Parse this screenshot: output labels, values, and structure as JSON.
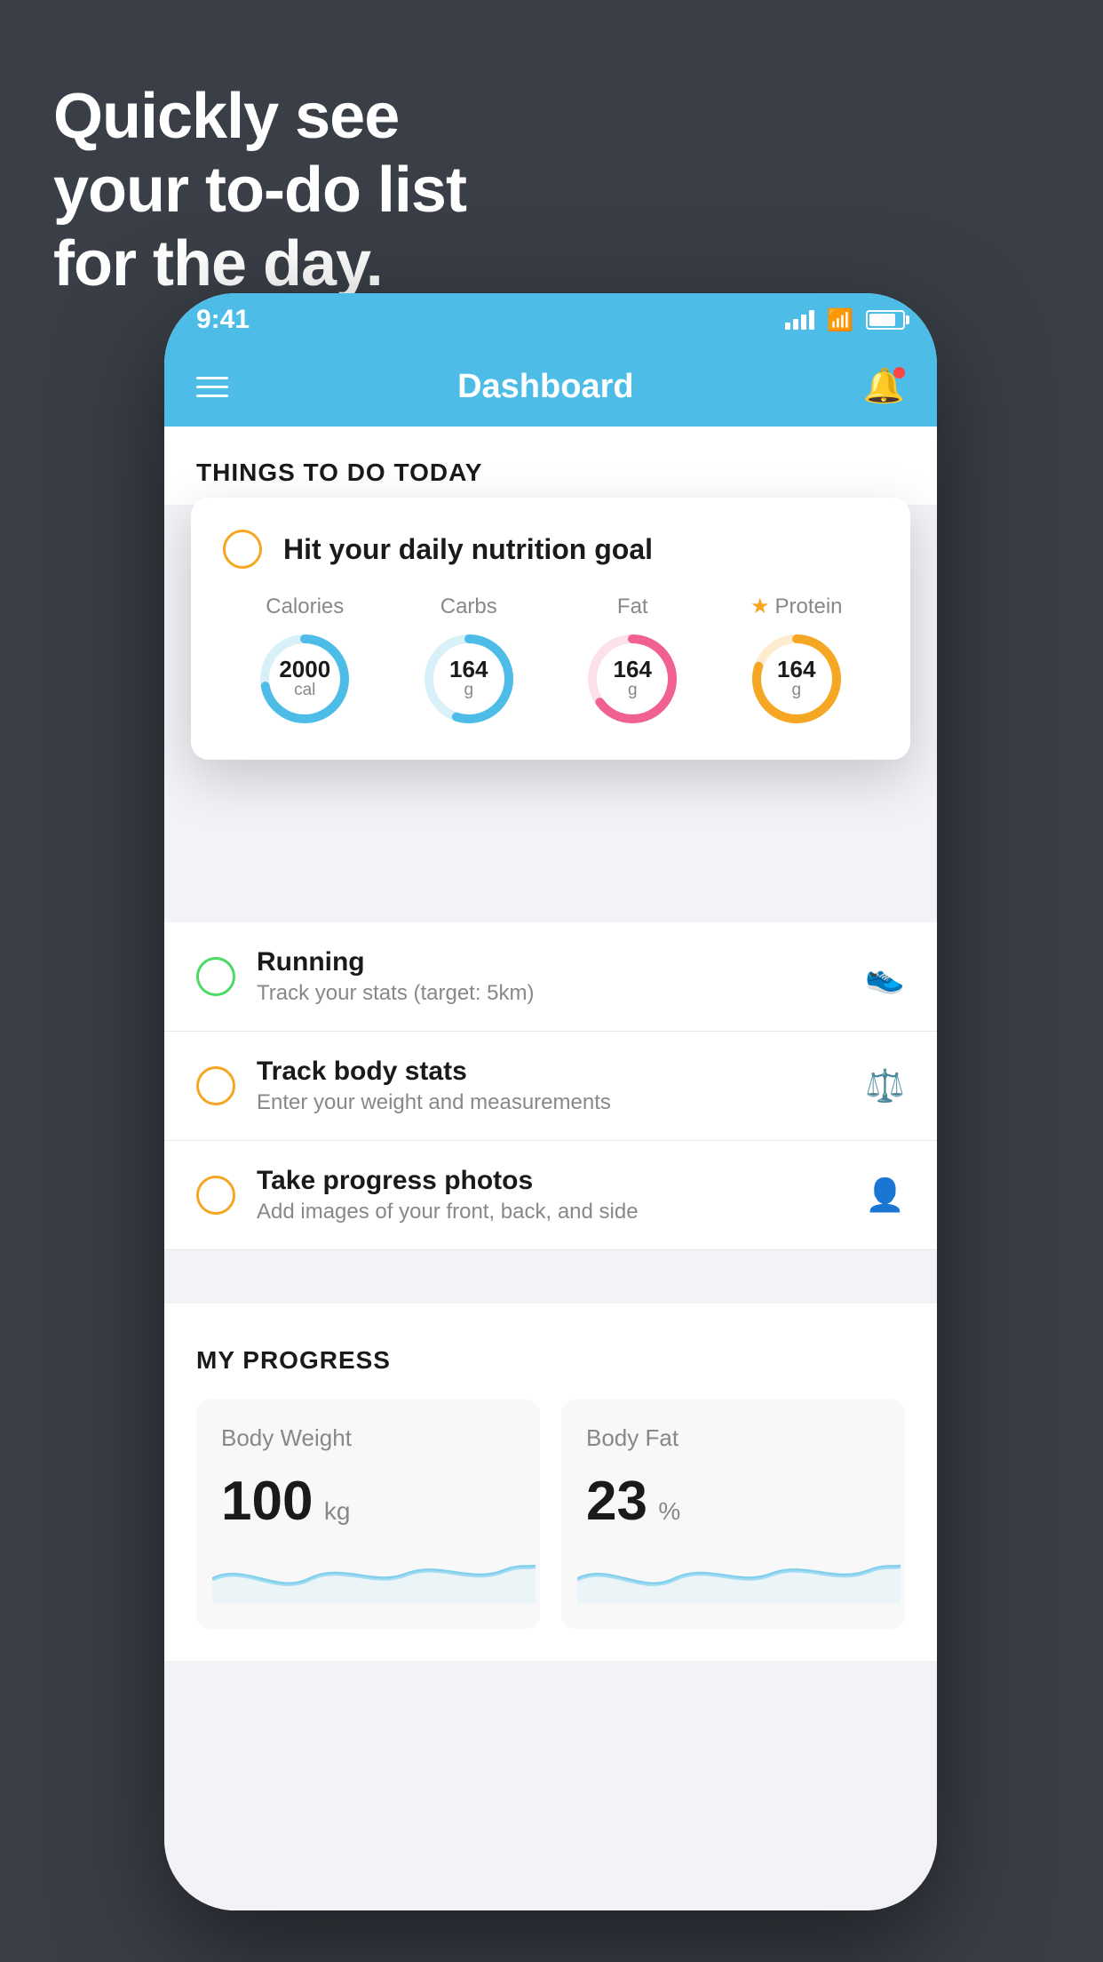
{
  "hero": {
    "line1": "Quickly see",
    "line2": "your to-do list",
    "line3": "for the day."
  },
  "status_bar": {
    "time": "9:41"
  },
  "nav": {
    "title": "Dashboard"
  },
  "things_section": {
    "title": "THINGS TO DO TODAY"
  },
  "floating_card": {
    "todo_title": "Hit your daily nutrition goal",
    "nutrients": [
      {
        "label": "Calories",
        "value": "2000",
        "unit": "cal",
        "color": "#4dbde8",
        "track_color": "#d8f0f8",
        "pct": 0.72,
        "starred": false
      },
      {
        "label": "Carbs",
        "value": "164",
        "unit": "g",
        "color": "#4dbde8",
        "track_color": "#d8f0f8",
        "pct": 0.55,
        "starred": false
      },
      {
        "label": "Fat",
        "value": "164",
        "unit": "g",
        "color": "#f06090",
        "track_color": "#fce0ea",
        "pct": 0.65,
        "starred": false
      },
      {
        "label": "Protein",
        "value": "164",
        "unit": "g",
        "color": "#f5a623",
        "track_color": "#fdecd0",
        "pct": 0.8,
        "starred": true
      }
    ]
  },
  "todo_list": [
    {
      "title": "Running",
      "subtitle": "Track your stats (target: 5km)",
      "circle_color": "green",
      "icon": "👟"
    },
    {
      "title": "Track body stats",
      "subtitle": "Enter your weight and measurements",
      "circle_color": "yellow",
      "icon": "⚖️"
    },
    {
      "title": "Take progress photos",
      "subtitle": "Add images of your front, back, and side",
      "circle_color": "yellow",
      "icon": "👤"
    }
  ],
  "progress": {
    "title": "MY PROGRESS",
    "cards": [
      {
        "label": "Body Weight",
        "value": "100",
        "unit": "kg"
      },
      {
        "label": "Body Fat",
        "value": "23",
        "unit": "%"
      }
    ]
  }
}
